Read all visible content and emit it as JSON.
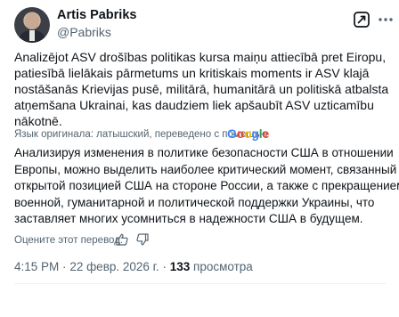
{
  "author": {
    "name": "Artis Pabriks",
    "handle": "@Pabriks"
  },
  "post": {
    "lines": [
      "Analizējot ASV drošības politikas kursa maiņu attiecībā pret Eiropu,",
      "patiesībā lielākais pārmetums un kritiskais moments ir ASV klajā",
      "nostāšanās Krievijas pusē, militārā, humanitārā un politiskā atbalsta",
      "atņemšana Ukrainai, kas daudziem liek apšaubīt ASV uzticamību",
      "nākotnē."
    ]
  },
  "translation": {
    "source_note": "Язык оригинала: латышский, переведено с помощью",
    "provider": "Google",
    "lines": [
      "Анализируя изменения в политике безопасности США в отношении",
      "Европы, можно выделить наиболее критический момент, связанный с",
      "открытой позицией США на стороне России, а также с прекращением",
      "военной, гуманитарной и политической поддержки Украины, что",
      "заставляет многих усомниться в надежности США в будущем."
    ],
    "rate_label": "Оцените этот перевод:"
  },
  "meta": {
    "time": "4:15 PM",
    "separator": "·",
    "date": "22 февр. 2026 г.",
    "views_count": "133",
    "views_label": "просмотра"
  },
  "icons": [
    "grok-icon",
    "more-icon",
    "thumbs-up-icon",
    "thumbs-down-icon"
  ],
  "colors": {
    "text_primary": "#0f1419",
    "text_secondary": "#536471",
    "divider": "#eff3f4",
    "google_blue": "#4285F4",
    "google_red": "#EA4335",
    "google_yellow": "#FBBC05",
    "google_green": "#34A853"
  }
}
